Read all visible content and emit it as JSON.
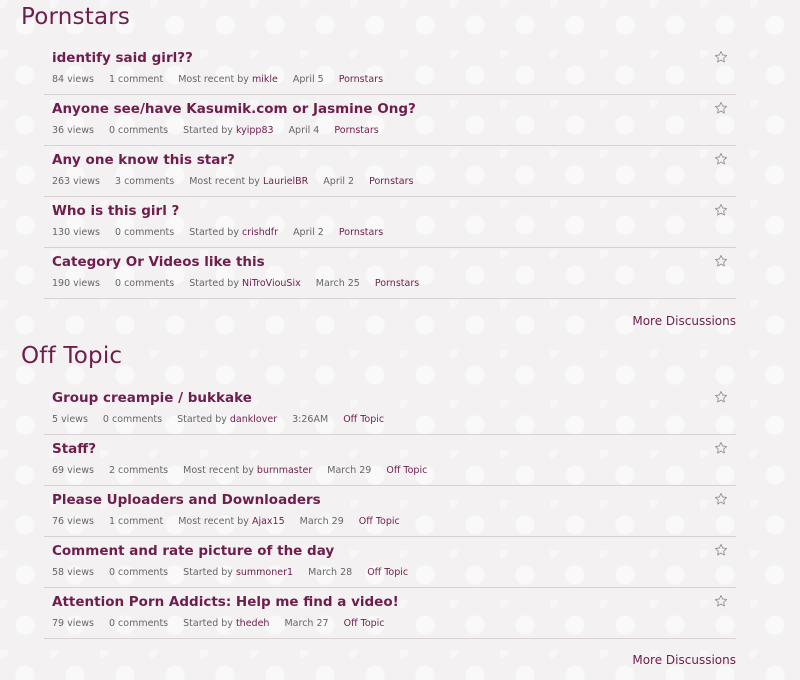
{
  "sections": [
    {
      "title": "Pornstars",
      "more": "More Discussions",
      "items": [
        {
          "title": "identify said girl??",
          "views": "84 views",
          "comments": "1 comment",
          "prefix": "Most recent by",
          "user": "mikle",
          "date": "April 5",
          "category": "Pornstars"
        },
        {
          "title": "Anyone see/have Kasumik.com or Jasmine Ong?",
          "views": "36 views",
          "comments": "0 comments",
          "prefix": "Started by",
          "user": "kyipp83",
          "date": "April 4",
          "category": "Pornstars"
        },
        {
          "title": "Any one know this star?",
          "views": "263 views",
          "comments": "3 comments",
          "prefix": "Most recent by",
          "user": "LaurielBR",
          "date": "April 2",
          "category": "Pornstars"
        },
        {
          "title": "Who is this girl ?",
          "views": "130 views",
          "comments": "0 comments",
          "prefix": "Started by",
          "user": "crishdfr",
          "date": "April 2",
          "category": "Pornstars"
        },
        {
          "title": "Category Or Videos like this",
          "views": "190 views",
          "comments": "0 comments",
          "prefix": "Started by",
          "user": "NiTroViouSix",
          "date": "March 25",
          "category": "Pornstars"
        }
      ]
    },
    {
      "title": "Off Topic",
      "more": "More Discussions",
      "items": [
        {
          "title": "Group creampie / bukkake",
          "views": "5 views",
          "comments": "0 comments",
          "prefix": "Started by",
          "user": "danklover",
          "date": "3:26AM",
          "category": "Off Topic"
        },
        {
          "title": "Staff?",
          "views": "69 views",
          "comments": "2 comments",
          "prefix": "Most recent by",
          "user": "burnmaster",
          "date": "March 29",
          "category": "Off Topic"
        },
        {
          "title": "Please Uploaders and Downloaders",
          "views": "76 views",
          "comments": "1 comment",
          "prefix": "Most recent by",
          "user": "Ajax15",
          "date": "March 29",
          "category": "Off Topic"
        },
        {
          "title": "Comment and rate picture of the day",
          "views": "58 views",
          "comments": "0 comments",
          "prefix": "Started by",
          "user": "summoner1",
          "date": "March 28",
          "category": "Off Topic"
        },
        {
          "title": "Attention Porn Addicts: Help me find a video!",
          "views": "79 views",
          "comments": "0 comments",
          "prefix": "Started by",
          "user": "thedeh",
          "date": "March 27",
          "category": "Off Topic"
        }
      ]
    }
  ],
  "icons": {
    "bookmark": "star-outline-icon"
  },
  "colors": {
    "accent": "#6e1e4c",
    "meta": "#666666",
    "divider": "#d8d2d5"
  }
}
